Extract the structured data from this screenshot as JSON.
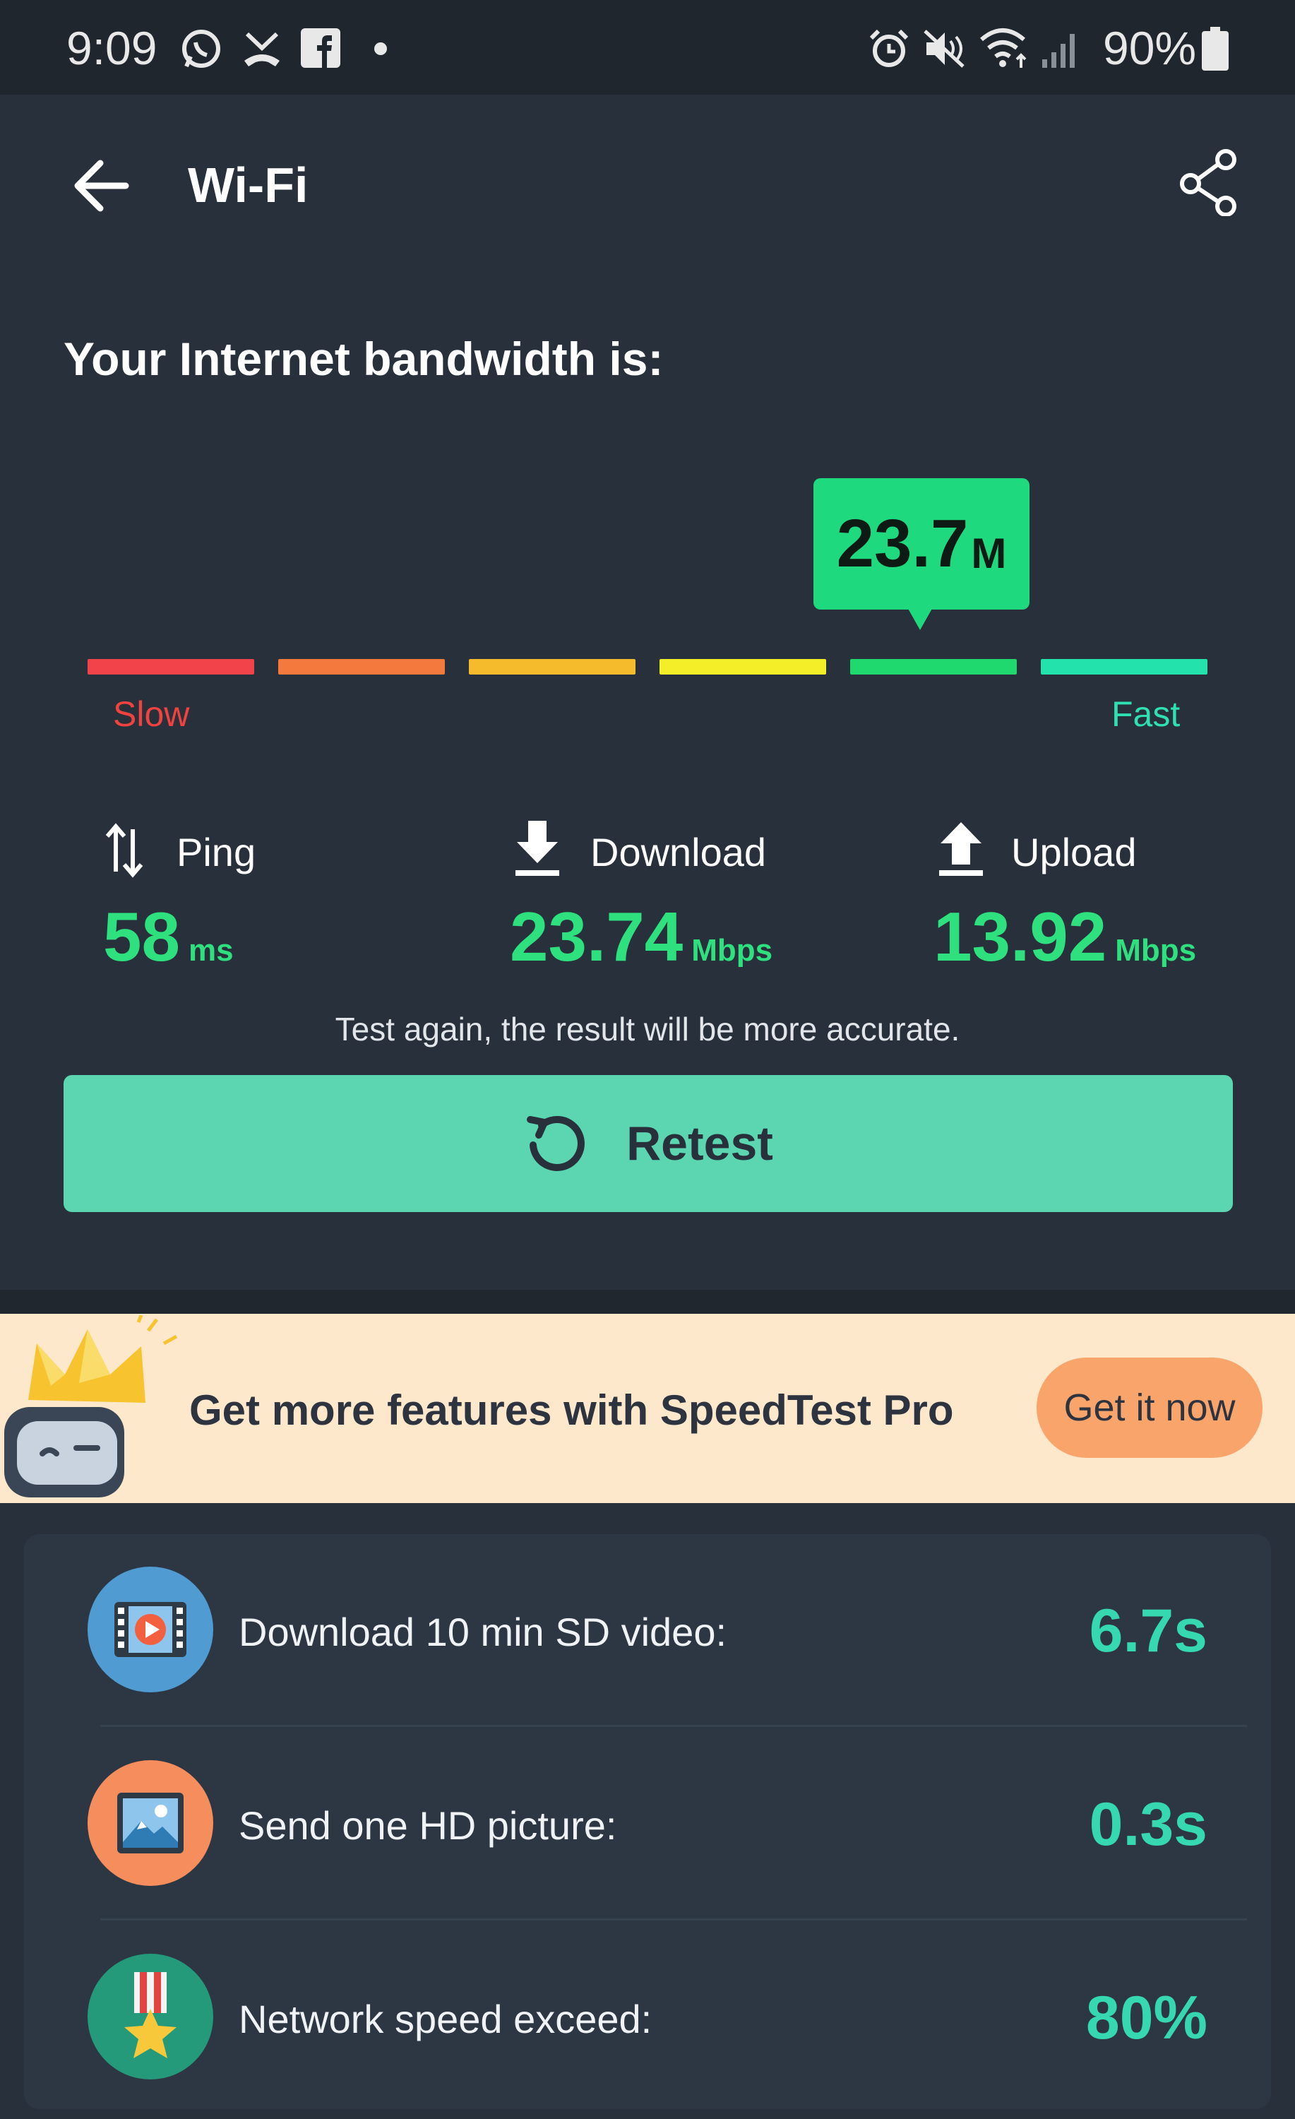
{
  "status_bar": {
    "time": "9:09",
    "battery": "90%",
    "icons": [
      "whatsapp-icon",
      "missed-call-icon",
      "facebook-icon",
      "dot-icon",
      "alarm-icon",
      "mute-icon",
      "wifi-icon",
      "signal-icon",
      "battery-icon"
    ]
  },
  "header": {
    "title": "Wi-Fi",
    "back_icon": "arrow-left-icon",
    "share_icon": "share-icon"
  },
  "bandwidth": {
    "heading": "Your Internet bandwidth is:",
    "bubble_value": "23.7",
    "bubble_unit": "M",
    "slow_label": "Slow",
    "fast_label": "Fast",
    "scale_colors": [
      "#f2434a",
      "#f4793c",
      "#f6ba2d",
      "#f3ee27",
      "#1fd96e",
      "#24e2ac"
    ],
    "active_segment": 5
  },
  "metrics": {
    "ping": {
      "label": "Ping",
      "value": "58",
      "unit": "ms",
      "icon": "ping-arrows-icon"
    },
    "download": {
      "label": "Download",
      "value": "23.74",
      "unit": "Mbps",
      "icon": "download-icon"
    },
    "upload": {
      "label": "Upload",
      "value": "13.92",
      "unit": "Mbps",
      "icon": "upload-icon"
    }
  },
  "hint": "Test again, the result will be more accurate.",
  "retest": {
    "label": "Retest",
    "icon": "retry-icon"
  },
  "promo": {
    "text": "Get more features with SpeedTest Pro",
    "button": "Get it now",
    "mascot_icon": "crown-robot-icon"
  },
  "info": {
    "items": [
      {
        "label": "Download 10 min SD video:",
        "value": "6.7s",
        "icon": "video-icon",
        "icon_color": "#4f9bd2"
      },
      {
        "label": "Send one HD picture:",
        "value": "0.3s",
        "icon": "picture-icon",
        "icon_color": "#f58e5c"
      },
      {
        "label": "Network speed exceed:",
        "value": "80%",
        "icon": "medal-icon",
        "icon_color": "#249a7a"
      }
    ]
  }
}
